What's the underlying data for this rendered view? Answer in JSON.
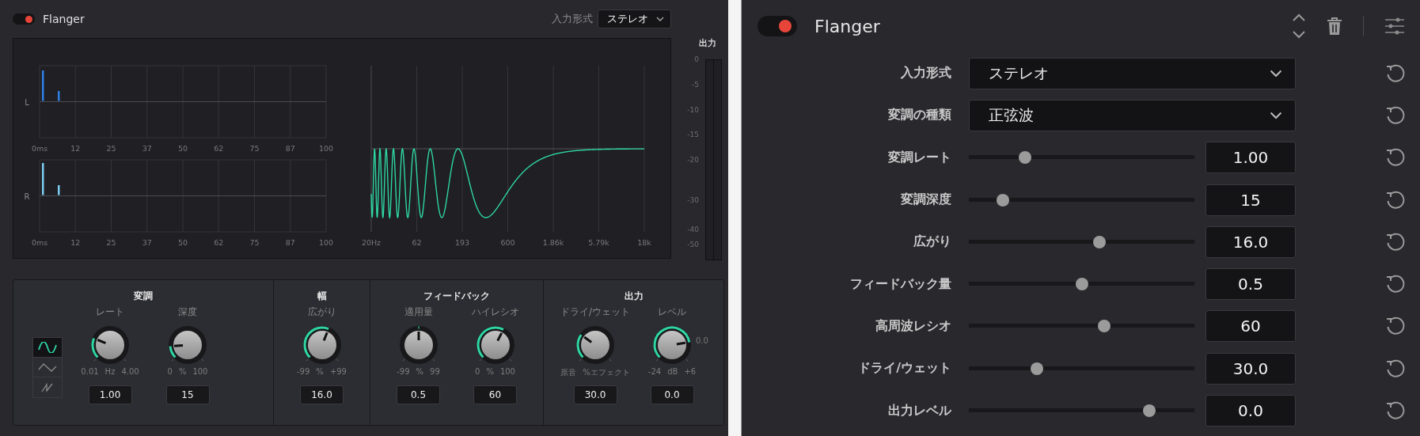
{
  "effect_panel": {
    "enabled": true,
    "title": "Flanger",
    "input_format": {
      "label": "入力形式",
      "value": "ステレオ"
    }
  },
  "impulse_charts": [
    {
      "channel": "L",
      "ticks": [
        "0ms",
        "12",
        "25",
        "37",
        "50",
        "62",
        "75",
        "87",
        "100"
      ]
    },
    {
      "channel": "R",
      "ticks": [
        "0ms",
        "12",
        "25",
        "37",
        "50",
        "62",
        "75",
        "87",
        "100"
      ]
    }
  ],
  "response_chart": {
    "ticks": [
      "20Hz",
      "62",
      "193",
      "600",
      "1.86k",
      "5.79k",
      "18k"
    ]
  },
  "meter": {
    "title": "出力",
    "scale": [
      "0",
      "-5",
      "-10",
      "-15",
      "-20",
      "-30",
      "-40",
      "-50"
    ]
  },
  "sections": [
    {
      "title": "変調",
      "waveforms": [
        {
          "kind": "sine",
          "selected": true
        },
        {
          "kind": "triangle",
          "selected": false
        },
        {
          "kind": "saw",
          "selected": false
        }
      ],
      "knobs": [
        {
          "label": "レート",
          "min": "0.01",
          "unit": "Hz",
          "max": "4.00",
          "value": "1.00",
          "kind": "start"
        },
        {
          "label": "深度",
          "min": "0",
          "unit": "%",
          "max": "100",
          "value": "15",
          "kind": "start"
        }
      ]
    },
    {
      "title": "幅",
      "knobs": [
        {
          "label": "広がり",
          "min": "-99",
          "unit": "%",
          "max": "+99",
          "value": "16.0",
          "kind": "start"
        }
      ]
    },
    {
      "title": "フィードバック",
      "knobs": [
        {
          "label": "適用量",
          "min": "-99",
          "unit": "%",
          "max": "99",
          "value": "0.5",
          "kind": "center"
        },
        {
          "label": "ハイレシオ",
          "min": "0",
          "unit": "%",
          "max": "100",
          "value": "60",
          "kind": "start"
        }
      ]
    },
    {
      "title": "出力",
      "knobs": [
        {
          "label": "ドライ/ウェット",
          "min": "原音",
          "max": "%エフェクト",
          "value": "30.0",
          "kind": "start"
        },
        {
          "label": "レベル",
          "min": "-24",
          "unit": "dB",
          "max": "+6",
          "value": "0.0",
          "kind": "start",
          "marker": "0.0"
        }
      ]
    }
  ],
  "inspector": {
    "enabled": true,
    "title": "Flanger",
    "rows": [
      {
        "kind": "dropdown",
        "label": "入力形式",
        "value": "ステレオ"
      },
      {
        "kind": "dropdown",
        "label": "変調の種類",
        "value": "正弦波"
      },
      {
        "kind": "slider",
        "label": "変調レート",
        "level": 0.25,
        "value": "1.00"
      },
      {
        "kind": "slider",
        "label": "変調深度",
        "level": 0.15,
        "value": "15"
      },
      {
        "kind": "slider",
        "label": "広がり",
        "level": 0.58,
        "value": "16.0"
      },
      {
        "kind": "slider",
        "label": "フィードバック量",
        "level": 0.5,
        "value": "0.5"
      },
      {
        "kind": "slider",
        "label": "高周波レシオ",
        "level": 0.6,
        "value": "60"
      },
      {
        "kind": "slider",
        "label": "ドライ/ウェット",
        "level": 0.3,
        "value": "30.0"
      },
      {
        "kind": "slider",
        "label": "出力レベル",
        "level": 0.8,
        "value": "0.0"
      }
    ]
  }
}
